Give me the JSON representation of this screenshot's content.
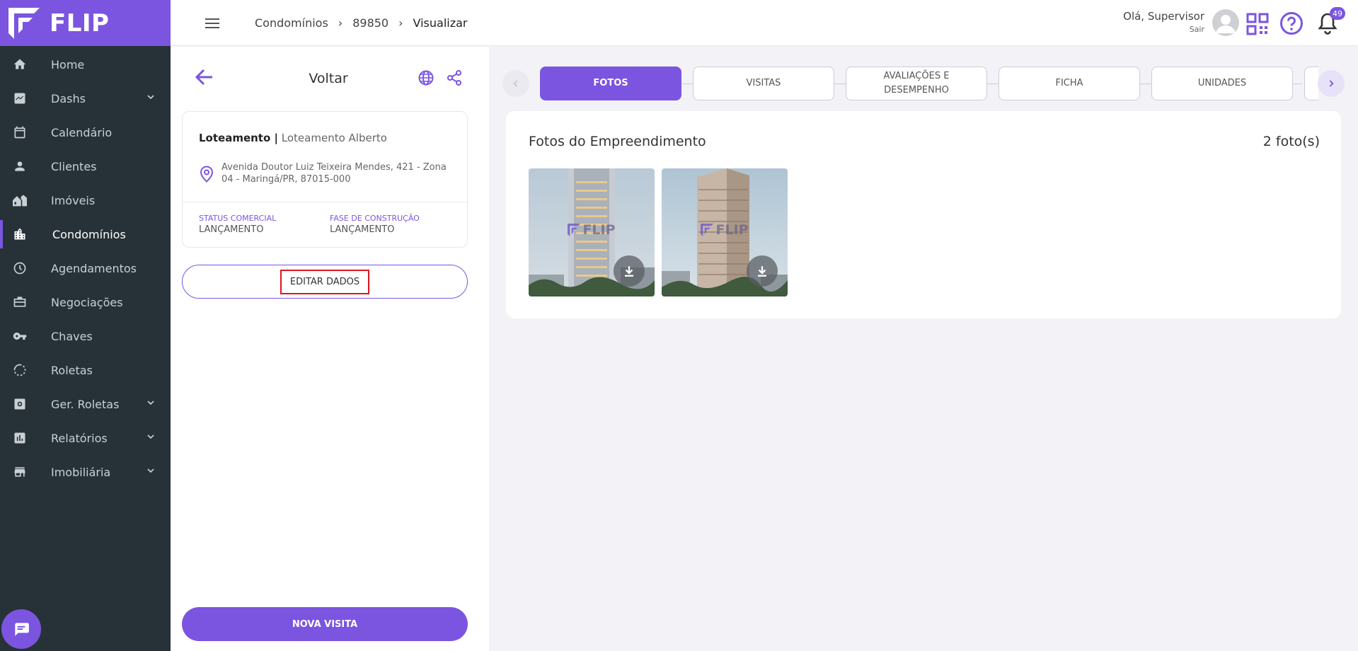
{
  "app": {
    "logo_text": "FLIP",
    "accent_color": "#7b55e0",
    "sidebar_color": "#273238"
  },
  "sidebar": {
    "items": [
      {
        "label": "Home",
        "icon": "home-icon"
      },
      {
        "label": "Dashs",
        "icon": "chart-icon",
        "expandable": true
      },
      {
        "label": "Calendário",
        "icon": "calendar-icon"
      },
      {
        "label": "Clientes",
        "icon": "person-icon"
      },
      {
        "label": "Imóveis",
        "icon": "houses-icon"
      },
      {
        "label": "Condomínios",
        "icon": "building-icon",
        "active": true
      },
      {
        "label": "Agendamentos",
        "icon": "clock-icon"
      },
      {
        "label": "Negociações",
        "icon": "briefcase-icon"
      },
      {
        "label": "Chaves",
        "icon": "key-icon"
      },
      {
        "label": "Roletas",
        "icon": "spinner-icon"
      },
      {
        "label": "Ger. Roletas",
        "icon": "settings-box-icon",
        "expandable": true
      },
      {
        "label": "Relatórios",
        "icon": "report-icon",
        "expandable": true
      },
      {
        "label": "Imobiliária",
        "icon": "store-icon",
        "expandable": true
      }
    ]
  },
  "header": {
    "breadcrumb": [
      "Condomínios",
      "89850",
      "Visualizar"
    ],
    "greeting": "Olá, Supervisor",
    "logout": "Sair",
    "notification_count": "49"
  },
  "detail": {
    "back_label": "Voltar",
    "type_label": "Loteamento |",
    "name": "Loteamento Alberto",
    "address": "Avenida Doutor Luiz Teixeira Mendes, 421 - Zona 04 - Maringá/PR, 87015-000",
    "status_label": "STATUS COMERCIAL",
    "status_value": "LANÇAMENTO",
    "phase_label": "FASE DE CONSTRUÇÃO",
    "phase_value": "LANÇAMENTO",
    "edit_button": "EDITAR DADOS",
    "new_visit_button": "NOVA VISITA"
  },
  "tabs": [
    {
      "label": "FOTOS",
      "active": true
    },
    {
      "label": "VISITAS",
      "active": false
    },
    {
      "label": "AVALIAÇÕES E DESEMPENHO",
      "active": false
    },
    {
      "label": "FICHA",
      "active": false
    },
    {
      "label": "UNIDADES",
      "active": false
    }
  ],
  "photos": {
    "title": "Fotos do Empreendimento",
    "count": "2 foto(s)",
    "watermark": "FLIP"
  }
}
